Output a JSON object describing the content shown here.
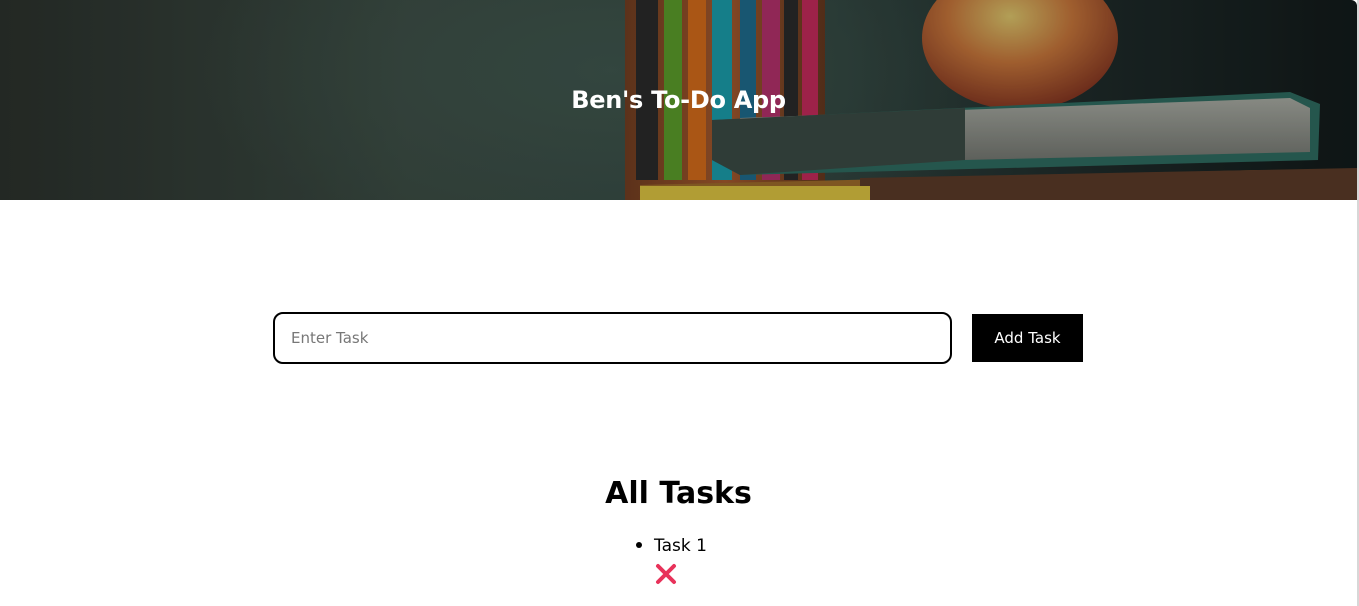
{
  "header": {
    "title": "Ben's To-Do App"
  },
  "form": {
    "input_placeholder": "Enter Task",
    "input_value": "",
    "add_label": "Add Task"
  },
  "tasks_section": {
    "title": "All Tasks",
    "items": [
      {
        "text": "Task 1",
        "delete_icon": "close-x-icon"
      }
    ]
  },
  "colors": {
    "accent_delete": "#e8325a",
    "button_bg": "#000000",
    "header_text": "#ffffff"
  }
}
